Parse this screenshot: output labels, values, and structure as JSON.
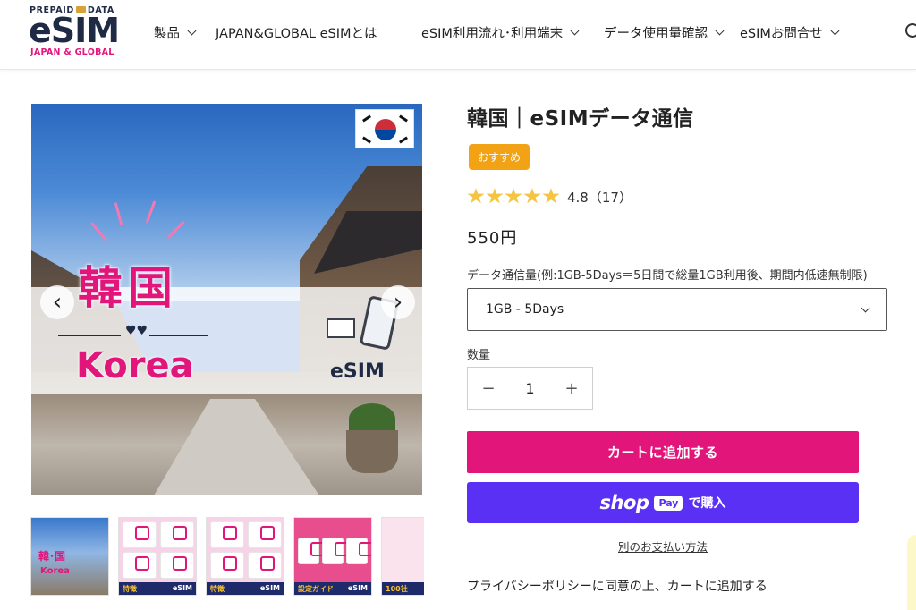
{
  "logo": {
    "top": "PREPAID",
    "top_right": "DATA",
    "main": "eSIM",
    "sub": "JAPAN & GLOBAL"
  },
  "nav": {
    "items": [
      {
        "label": "製品",
        "dropdown": true
      },
      {
        "label": "JAPAN&GLOBAL eSIMとは",
        "dropdown": false
      },
      {
        "label": "eSIM利用流れ･利用端末",
        "dropdown": true
      },
      {
        "label": "データ使用量確認",
        "dropdown": true
      },
      {
        "label": "eSIMお問合せ",
        "dropdown": true
      }
    ]
  },
  "gallery": {
    "main_title": "韓国",
    "main_subtitle": "Korea",
    "esim_label": "eSIM",
    "thumbs": [
      {
        "caption_a": "韓･国",
        "caption_b": "Korea"
      },
      {
        "caption_a": "特徴",
        "caption_b": "eSIM"
      },
      {
        "caption_a": "特徴",
        "caption_b": "eSIM"
      },
      {
        "caption_a": "設定ガイド",
        "caption_b": "eSIM"
      },
      {
        "caption_a": "100社",
        "caption_b": ""
      }
    ]
  },
  "product": {
    "title": "韓国｜eSIMデータ通信",
    "badge": "おすすめ",
    "rating_value": 4.8,
    "rating_text": "4.8（17）",
    "price": "550円",
    "option_label": "データ通信量(例:1GB-5Days＝5日間で総量1GB利用後、期間内低速無制限)",
    "option_selected": "1GB - 5Days",
    "qty_label": "数量",
    "qty_minus": "−",
    "qty_value": "1",
    "qty_plus": "+",
    "add_to_cart": "カートに追加する",
    "shop_word": "shop",
    "shop_pay": "Pay",
    "shop_buy": "で購入",
    "alt_payment": "別のお支払い方法",
    "privacy": "プライバシーポリシーに同意の上、カートに追加する"
  },
  "colors": {
    "brand_pink": "#e2157b",
    "shop_purple": "#5a31f4",
    "badge_orange": "#f2a315",
    "star": "#f4c540"
  }
}
